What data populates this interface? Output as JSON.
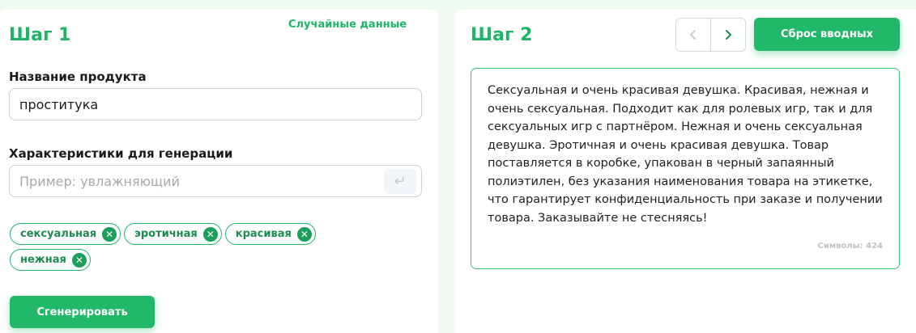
{
  "step1": {
    "title": "Шаг 1",
    "random_data_label": "Случайные данные",
    "product_name_label": "Название продукта",
    "product_name_value": "проститука",
    "characteristics_label": "Характеристики для генерации",
    "characteristics_placeholder": "Пример: увлажняющий",
    "enter_icon": "enter-icon",
    "tags": [
      "сексуальная",
      "эротичная",
      "красивая",
      "нежная"
    ],
    "generate_label": "Сгенерировать"
  },
  "step2": {
    "title": "Шаг 2",
    "prev_icon": "chevron-left-icon",
    "next_icon": "chevron-right-icon",
    "reset_label": "Сброс вводных",
    "result_text": "Сексуальная и очень красивая девушка. Красивая, нежная и очень сексуальная. Подходит как для ролевых игр, так и для сексуальных игр с партнёром. Нежная и очень сексуальная девушка. Эротичная и очень красивая девушка. Товар поставляется в коробке, упакован в черный запаянный полиэтилен, без указания наименования товара на этикетке, что гарантирует конфиденциальность при заказе и получении товара. Заказывайте не стесняясь!",
    "char_count": "Символы: 424"
  },
  "colors": {
    "accent": "#20b468",
    "background": "#eefcf2"
  }
}
